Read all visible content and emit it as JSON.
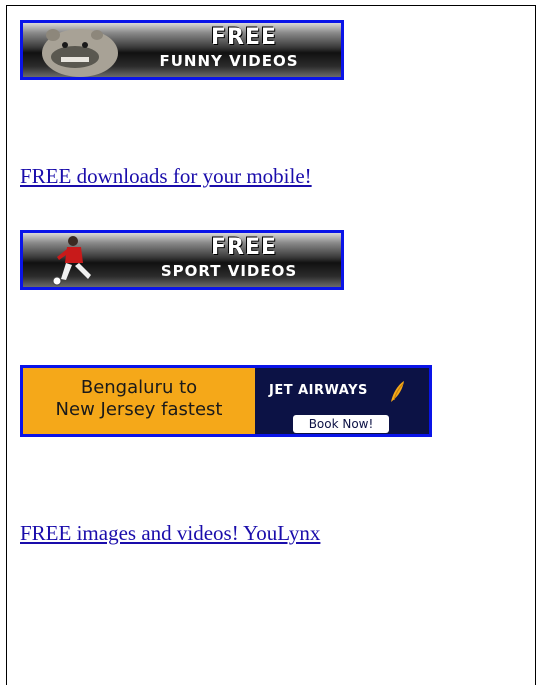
{
  "banners": {
    "funny": {
      "title": "FREE",
      "subtitle": "FUNNY VIDEOS"
    },
    "sport": {
      "title": "FREE",
      "subtitle": "SPORT VIDEOS"
    }
  },
  "links": {
    "mobile": "FREE downloads for your mobile!",
    "youlynx": "FREE images and videos! YouLynx"
  },
  "jet_ad": {
    "line1": "Bengaluru to",
    "line2": "New Jersey fastest",
    "brand": "JET AIRWAYS",
    "cta": "Book Now!"
  },
  "colors": {
    "banner_border": "#0a14e8",
    "link": "#1a0dab",
    "jet_orange": "#f5a819",
    "jet_navy": "#0c1245"
  }
}
